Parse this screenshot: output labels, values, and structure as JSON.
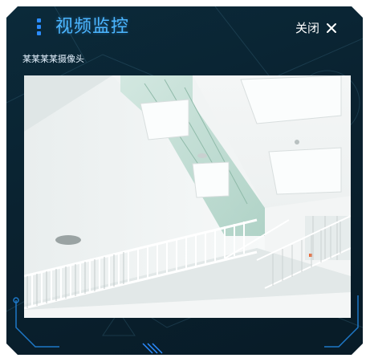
{
  "header": {
    "title": "视频监控",
    "close_label": "关闭"
  },
  "camera": {
    "name": "某某某某摄像头"
  },
  "icons": {
    "close": "close-icon",
    "title_accent": "vertical-dots-icon"
  },
  "colors": {
    "panel_bg": "#0a2230",
    "title": "#4bb6ff",
    "accent": "#2b8cff",
    "text": "#ffffff"
  }
}
